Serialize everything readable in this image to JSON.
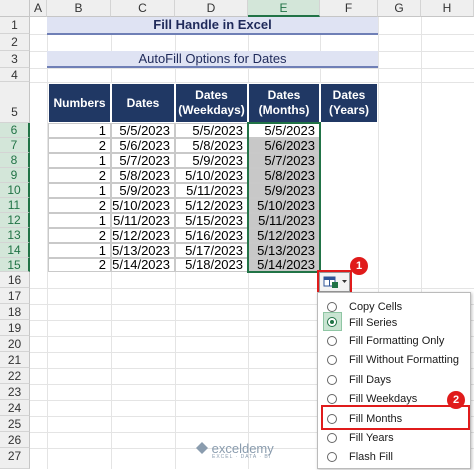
{
  "columns": [
    "A",
    "B",
    "C",
    "D",
    "E",
    "F",
    "G",
    "H"
  ],
  "rows": [
    "1",
    "2",
    "3",
    "4",
    "5",
    "6",
    "7",
    "8",
    "9",
    "10",
    "11",
    "12",
    "13",
    "14",
    "15",
    "16",
    "17",
    "18",
    "19",
    "20",
    "21",
    "22",
    "23",
    "24",
    "25",
    "26",
    "27"
  ],
  "title": "Fill Handle in Excel",
  "subtitle": "AutoFill Options for Dates",
  "table": {
    "headers": [
      "Numbers",
      "Dates",
      "Dates (Weekdays)",
      "Dates (Months)",
      "Dates (Years)"
    ],
    "rows": [
      [
        "1",
        "5/5/2023",
        "5/5/2023",
        "5/5/2023"
      ],
      [
        "2",
        "5/6/2023",
        "5/8/2023",
        "5/6/2023"
      ],
      [
        "1",
        "5/7/2023",
        "5/9/2023",
        "5/7/2023"
      ],
      [
        "2",
        "5/8/2023",
        "5/10/2023",
        "5/8/2023"
      ],
      [
        "1",
        "5/9/2023",
        "5/11/2023",
        "5/9/2023"
      ],
      [
        "2",
        "5/10/2023",
        "5/12/2023",
        "5/10/2023"
      ],
      [
        "1",
        "5/11/2023",
        "5/15/2023",
        "5/11/2023"
      ],
      [
        "2",
        "5/12/2023",
        "5/16/2023",
        "5/12/2023"
      ],
      [
        "1",
        "5/13/2023",
        "5/17/2023",
        "5/13/2023"
      ],
      [
        "2",
        "5/14/2023",
        "5/18/2023",
        "5/14/2023"
      ]
    ]
  },
  "autofill_button_icon": "autofill-options-icon",
  "menu": {
    "items": [
      {
        "label": "Copy Cells",
        "selected": false
      },
      {
        "label": "Fill Series",
        "selected": true
      },
      {
        "label": "Fill Formatting Only",
        "selected": false
      },
      {
        "label": "Fill Without Formatting",
        "selected": false
      },
      {
        "label": "Fill Days",
        "selected": false
      },
      {
        "label": "Fill Weekdays",
        "selected": false
      },
      {
        "label": "Fill Months",
        "selected": false
      },
      {
        "label": "Fill Years",
        "selected": false
      },
      {
        "label": "Flash Fill",
        "selected": false
      }
    ]
  },
  "badges": {
    "one": "1",
    "two": "2"
  },
  "watermark": {
    "brand": "exceldemy",
    "tagline": "EXCEL · DATA · BI"
  },
  "colors": {
    "header_bg": "#203864",
    "accent": "#217346",
    "highlight": "#e01b1b",
    "title_bg": "#dfe3f3"
  }
}
